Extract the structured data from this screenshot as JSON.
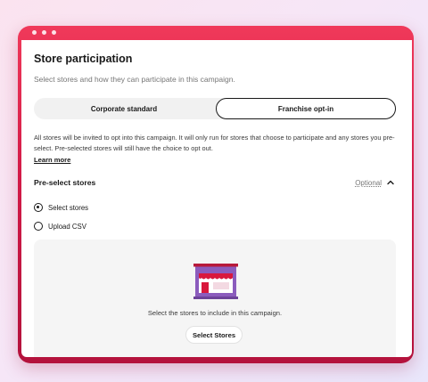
{
  "header": {
    "title": "Store participation",
    "subtitle": "Select stores and how they can participate in this campaign."
  },
  "mode_toggle": {
    "options": [
      "Corporate standard",
      "Franchise opt-in"
    ],
    "selected": "Franchise opt-in"
  },
  "description": "All stores will be invited to opt into this campaign. It will only run for stores that choose to participate and any stores you pre-select. Pre-selected stores will still have the choice to opt out.",
  "learn_more": "Learn more",
  "preselect": {
    "title": "Pre-select stores",
    "optional": "Optional",
    "expanded": true,
    "options": [
      "Select stores",
      "Upload CSV"
    ],
    "selected": "Select stores"
  },
  "empty_state": {
    "icon": "storefront-icon",
    "text": "Select the stores to include in this campaign.",
    "button": "Select Stores"
  },
  "colors": {
    "frame_accent": "#d21a47",
    "text_primary": "#191919",
    "text_secondary": "#767676",
    "store_icon": "#8b5cbd",
    "awning_red": "#d9183d"
  }
}
